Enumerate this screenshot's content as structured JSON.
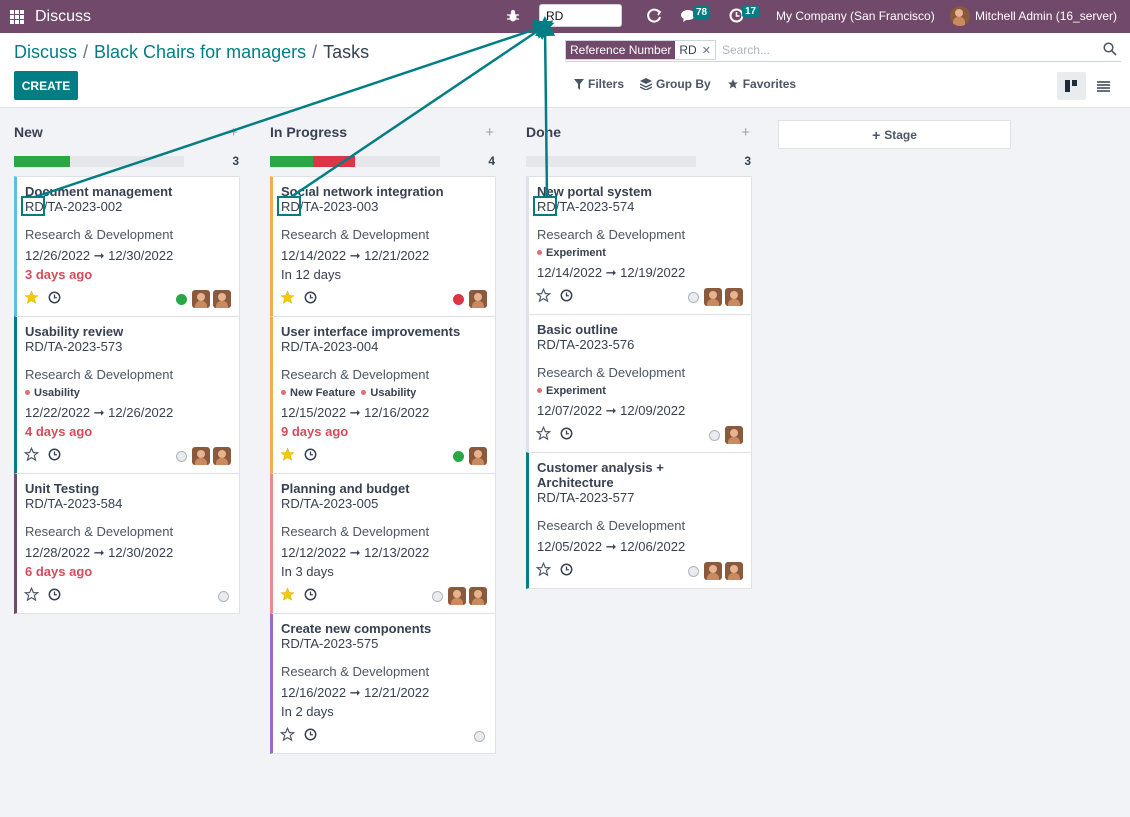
{
  "navbar": {
    "brand": "Discuss",
    "search_value": "RD",
    "messages_count": "78",
    "activities_count": "17",
    "company": "My Company (San Francisco)",
    "user": "Mitchell Admin (16_server)"
  },
  "breadcrumb": [
    "Discuss",
    "Black Chairs for managers",
    "Tasks"
  ],
  "create_label": "CREATE",
  "search": {
    "facet_label": "Reference Number",
    "facet_value": "RD",
    "placeholder": "Search..."
  },
  "control_buttons": {
    "filters": "Filters",
    "group_by": "Group By",
    "favorites": "Favorites"
  },
  "add_stage_label": "Stage",
  "colors": {
    "navbar": "#71496a",
    "primary": "#017e84",
    "overdue": "#d44c59",
    "done_green": "#28a745",
    "blocked_red": "#dc3545"
  },
  "columns": [
    {
      "title": "New",
      "count": "3",
      "progress": [
        {
          "color": "#28a745",
          "fraction": 0.33
        }
      ],
      "cards": [
        {
          "name": "Document management",
          "ref": "RD/TA-2023-002",
          "project": "Research & Development",
          "tags": [],
          "dates": "12/26/2022 ➞ 12/30/2022",
          "deadline": "3 days ago",
          "deadline_overdue": true,
          "starred": true,
          "status": "green",
          "avatars": 2,
          "border": "#5bc0de",
          "highlight": true
        },
        {
          "name": "Usability review",
          "ref": "RD/TA-2023-573",
          "project": "Research & Development",
          "tags": [
            "Usability"
          ],
          "dates": "12/22/2022 ➞ 12/26/2022",
          "deadline": "4 days ago",
          "deadline_overdue": true,
          "starred": false,
          "status": "grey",
          "avatars": 2,
          "border": "#017e84",
          "highlight": false
        },
        {
          "name": "Unit Testing",
          "ref": "RD/TA-2023-584",
          "project": "Research & Development",
          "tags": [],
          "dates": "12/28/2022 ➞ 12/30/2022",
          "deadline": "6 days ago",
          "deadline_overdue": true,
          "starred": false,
          "status": "grey",
          "avatars": 0,
          "border": "#71496a",
          "highlight": false
        }
      ]
    },
    {
      "title": "In Progress",
      "count": "4",
      "progress": [
        {
          "color": "#28a745",
          "fraction": 0.25
        },
        {
          "color": "#dc3545",
          "fraction": 0.25
        }
      ],
      "cards": [
        {
          "name": "Social network integration",
          "ref": "RD/TA-2023-003",
          "project": "Research & Development",
          "tags": [],
          "dates": "12/14/2022 ➞ 12/21/2022",
          "deadline": "In 12 days",
          "deadline_overdue": false,
          "starred": true,
          "status": "red",
          "avatars": 1,
          "border": "#f0ad4e",
          "highlight": true
        },
        {
          "name": "User interface improvements",
          "ref": "RD/TA-2023-004",
          "project": "Research & Development",
          "tags": [
            "New Feature",
            "Usability"
          ],
          "dates": "12/15/2022 ➞ 12/16/2022",
          "deadline": "9 days ago",
          "deadline_overdue": true,
          "starred": true,
          "status": "green",
          "avatars": 1,
          "border": "#f0ad4e",
          "highlight": false
        },
        {
          "name": "Planning and budget",
          "ref": "RD/TA-2023-005",
          "project": "Research & Development",
          "tags": [],
          "dates": "12/12/2022 ➞ 12/13/2022",
          "deadline": "In 3 days",
          "deadline_overdue": false,
          "starred": true,
          "status": "grey",
          "avatars": 2,
          "border": "#e88b8b",
          "highlight": false
        },
        {
          "name": "Create new components",
          "ref": "RD/TA-2023-575",
          "project": "Research & Development",
          "tags": [],
          "dates": "12/16/2022 ➞ 12/21/2022",
          "deadline": "In 2 days",
          "deadline_overdue": false,
          "starred": false,
          "status": "grey",
          "avatars": 0,
          "border": "#9b6bc4",
          "highlight": false
        }
      ]
    },
    {
      "title": "Done",
      "count": "3",
      "progress": [],
      "cards": [
        {
          "name": "New portal system",
          "ref": "RD/TA-2023-574",
          "project": "Research & Development",
          "tags": [
            "Experiment"
          ],
          "dates": "12/14/2022 ➞ 12/19/2022",
          "deadline": "",
          "deadline_overdue": false,
          "starred": false,
          "status": "grey",
          "avatars": 2,
          "border": "#dee2e6",
          "highlight": true
        },
        {
          "name": "Basic outline",
          "ref": "RD/TA-2023-576",
          "project": "Research & Development",
          "tags": [
            "Experiment"
          ],
          "dates": "12/07/2022 ➞ 12/09/2022",
          "deadline": "",
          "deadline_overdue": false,
          "starred": false,
          "status": "grey",
          "avatars": 1,
          "border": "#dee2e6",
          "highlight": false
        },
        {
          "name": "Customer analysis + Architecture",
          "ref": "RD/TA-2023-577",
          "project": "Research & Development",
          "tags": [],
          "dates": "12/05/2022 ➞ 12/06/2022",
          "deadline": "",
          "deadline_overdue": false,
          "starred": false,
          "status": "grey",
          "avatars": 2,
          "border": "#017e84",
          "highlight": false
        }
      ]
    }
  ]
}
